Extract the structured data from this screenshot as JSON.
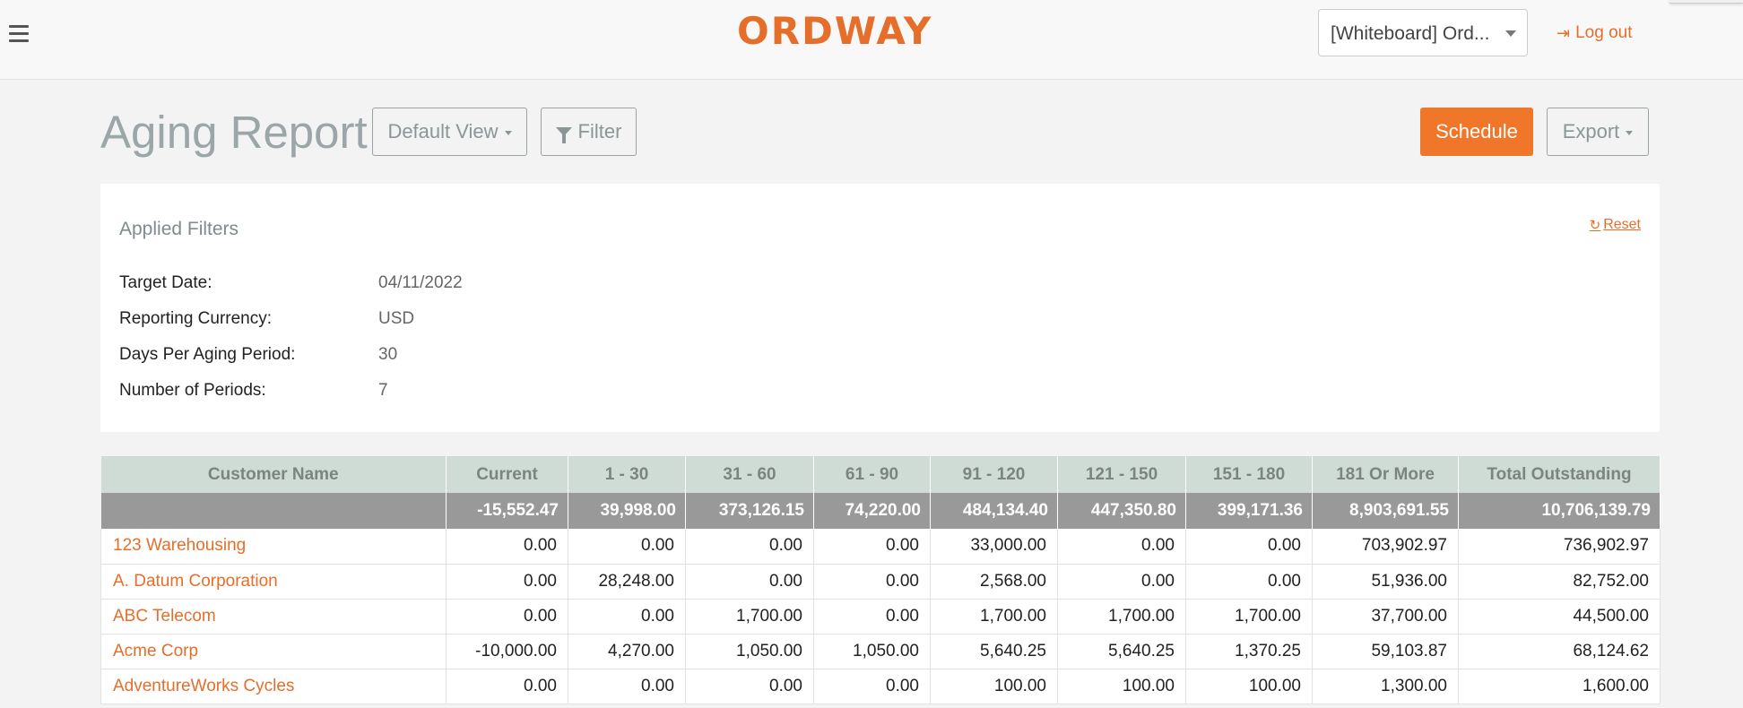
{
  "header": {
    "logo_text": "ORDWAY",
    "workspace_selector": "[Whiteboard] Ord...",
    "logout_label": "Log out"
  },
  "page": {
    "title": "Aging Report",
    "view_dropdown": "Default View",
    "filter_label": "Filter",
    "schedule_label": "Schedule",
    "export_label": "Export"
  },
  "applied_filters": {
    "title": "Applied Filters",
    "reset_label": "Reset",
    "rows": [
      {
        "label": "Target Date:",
        "value": "04/11/2022"
      },
      {
        "label": "Reporting Currency:",
        "value": "USD"
      },
      {
        "label": "Days Per Aging Period:",
        "value": "30"
      },
      {
        "label": "Number of Periods:",
        "value": "7"
      }
    ]
  },
  "table": {
    "columns": [
      "Customer Name",
      "Current",
      "1 - 30",
      "31 - 60",
      "61 - 90",
      "91 - 120",
      "121 - 150",
      "151 - 180",
      "181 Or More",
      "Total Outstanding"
    ],
    "totals": [
      "",
      "-15,552.47",
      "39,998.00",
      "373,126.15",
      "74,220.00",
      "484,134.40",
      "447,350.80",
      "399,171.36",
      "8,903,691.55",
      "10,706,139.79"
    ],
    "rows": [
      [
        "123 Warehousing",
        "0.00",
        "0.00",
        "0.00",
        "0.00",
        "33,000.00",
        "0.00",
        "0.00",
        "703,902.97",
        "736,902.97"
      ],
      [
        "A. Datum Corporation",
        "0.00",
        "28,248.00",
        "0.00",
        "0.00",
        "2,568.00",
        "0.00",
        "0.00",
        "51,936.00",
        "82,752.00"
      ],
      [
        "ABC Telecom",
        "0.00",
        "0.00",
        "1,700.00",
        "0.00",
        "1,700.00",
        "1,700.00",
        "1,700.00",
        "37,700.00",
        "44,500.00"
      ],
      [
        "Acme Corp",
        "-10,000.00",
        "4,270.00",
        "1,050.00",
        "1,050.00",
        "5,640.25",
        "5,640.25",
        "1,370.25",
        "59,103.87",
        "68,124.62"
      ],
      [
        "AdventureWorks Cycles",
        "0.00",
        "0.00",
        "0.00",
        "0.00",
        "100.00",
        "100.00",
        "100.00",
        "1,300.00",
        "1,600.00"
      ]
    ]
  },
  "colors": {
    "accent": "#f0772a",
    "link": "#e56f2a",
    "header_row": "#cfdcd6",
    "totals_row": "#999999"
  }
}
